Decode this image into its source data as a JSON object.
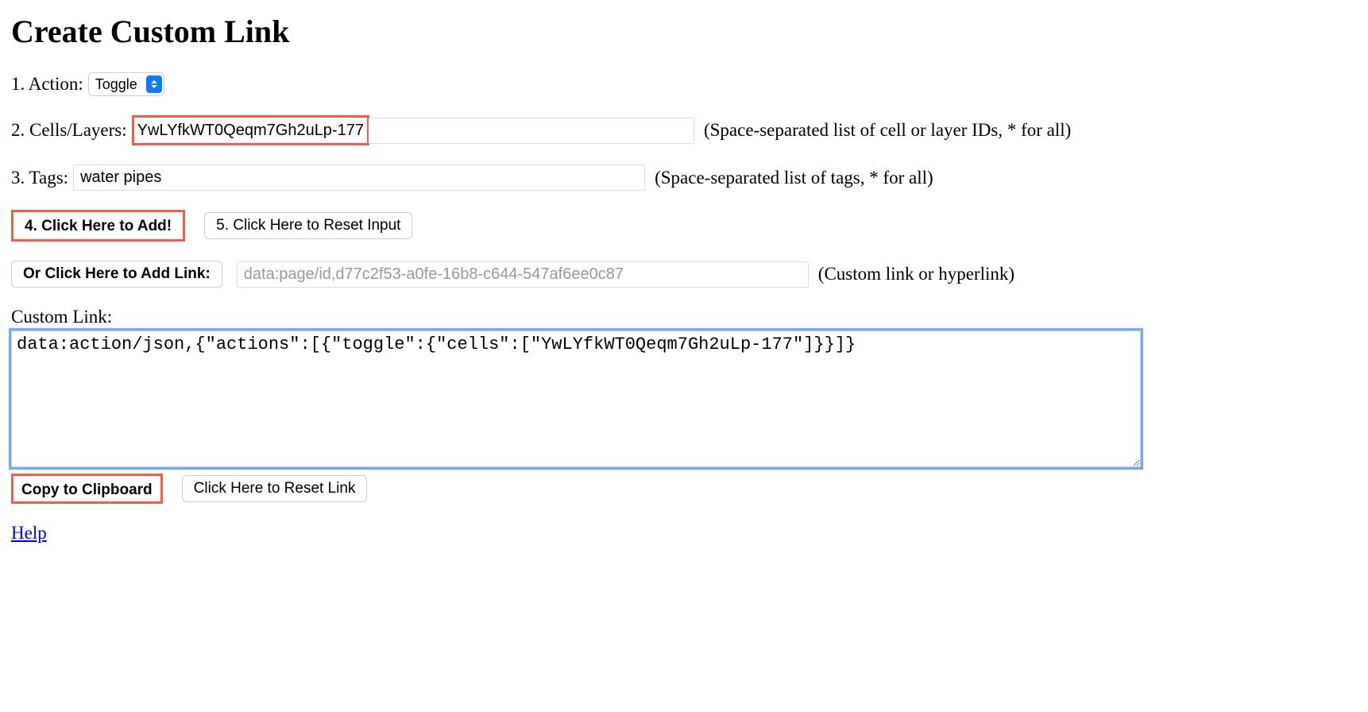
{
  "title": "Create Custom Link",
  "action": {
    "label": "1. Action:",
    "selected": "Toggle"
  },
  "cells": {
    "label": "2. Cells/Layers:",
    "value_highlighted": "YwLYfkWT0Qeqm7Gh2uLp-177",
    "value_rest": "",
    "hint": "(Space-separated list of cell or layer IDs, * for all)"
  },
  "tags": {
    "label": "3. Tags:",
    "value": "water pipes",
    "hint": "(Space-separated list of tags, * for all)"
  },
  "buttons": {
    "add": "4. Click Here to Add!",
    "reset_input": "5. Click Here to Reset Input",
    "add_link": "Or Click Here to Add Link:",
    "copy": "Copy to Clipboard",
    "reset_link": "Click Here to Reset Link"
  },
  "link_input": {
    "placeholder": "data:page/id,d77c2f53-a0fe-16b8-c644-547af6ee0c87",
    "hint": "(Custom link or hyperlink)"
  },
  "custom_link": {
    "label": "Custom Link:",
    "value": "data:action/json,{\"actions\":[{\"toggle\":{\"cells\":[\"YwLYfkWT0Qeqm7Gh2uLp-177\"]}}]}"
  },
  "help": "Help"
}
